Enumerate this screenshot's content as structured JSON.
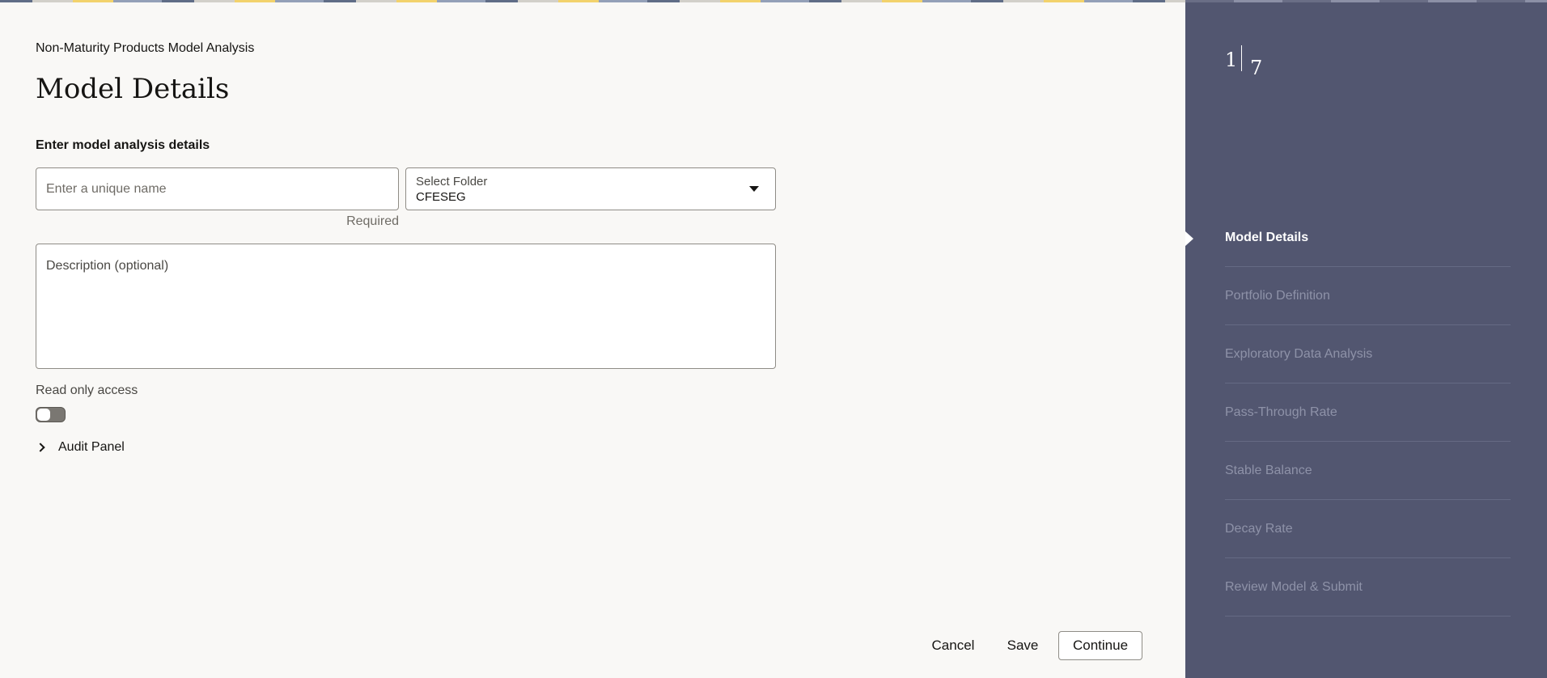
{
  "header": {
    "breadcrumb": "Non-Maturity Products Model Analysis",
    "title": "Model Details"
  },
  "form": {
    "section_label": "Enter model analysis details",
    "name_placeholder": "Enter a unique name",
    "name_value": "",
    "name_helper": "Required",
    "folder_label": "Select Folder",
    "folder_value": "CFESEG",
    "description_placeholder": "Description (optional)",
    "description_value": "",
    "read_only_label": "Read only access",
    "read_only_enabled": false,
    "audit_panel_label": "Audit Panel"
  },
  "footer": {
    "cancel_label": "Cancel",
    "save_label": "Save",
    "continue_label": "Continue"
  },
  "train": {
    "current_step": "1",
    "total_steps": "7",
    "steps": [
      {
        "label": "Model Details",
        "active": true
      },
      {
        "label": "Portfolio Definition",
        "active": false
      },
      {
        "label": "Exploratory Data Analysis",
        "active": false
      },
      {
        "label": "Pass-Through Rate",
        "active": false
      },
      {
        "label": "Stable Balance",
        "active": false
      },
      {
        "label": "Decay Rate",
        "active": false
      },
      {
        "label": "Review Model & Submit",
        "active": false
      }
    ]
  },
  "colors": {
    "sidebar_bg": "#525670",
    "page_bg": "#f9f8f6",
    "inactive_step_text": "#8e92a8"
  },
  "icons": {
    "folder_dropdown": "caret-down-icon",
    "audit_toggle": "chevron-right-icon",
    "current_step": "triangle-pointer-icon"
  }
}
